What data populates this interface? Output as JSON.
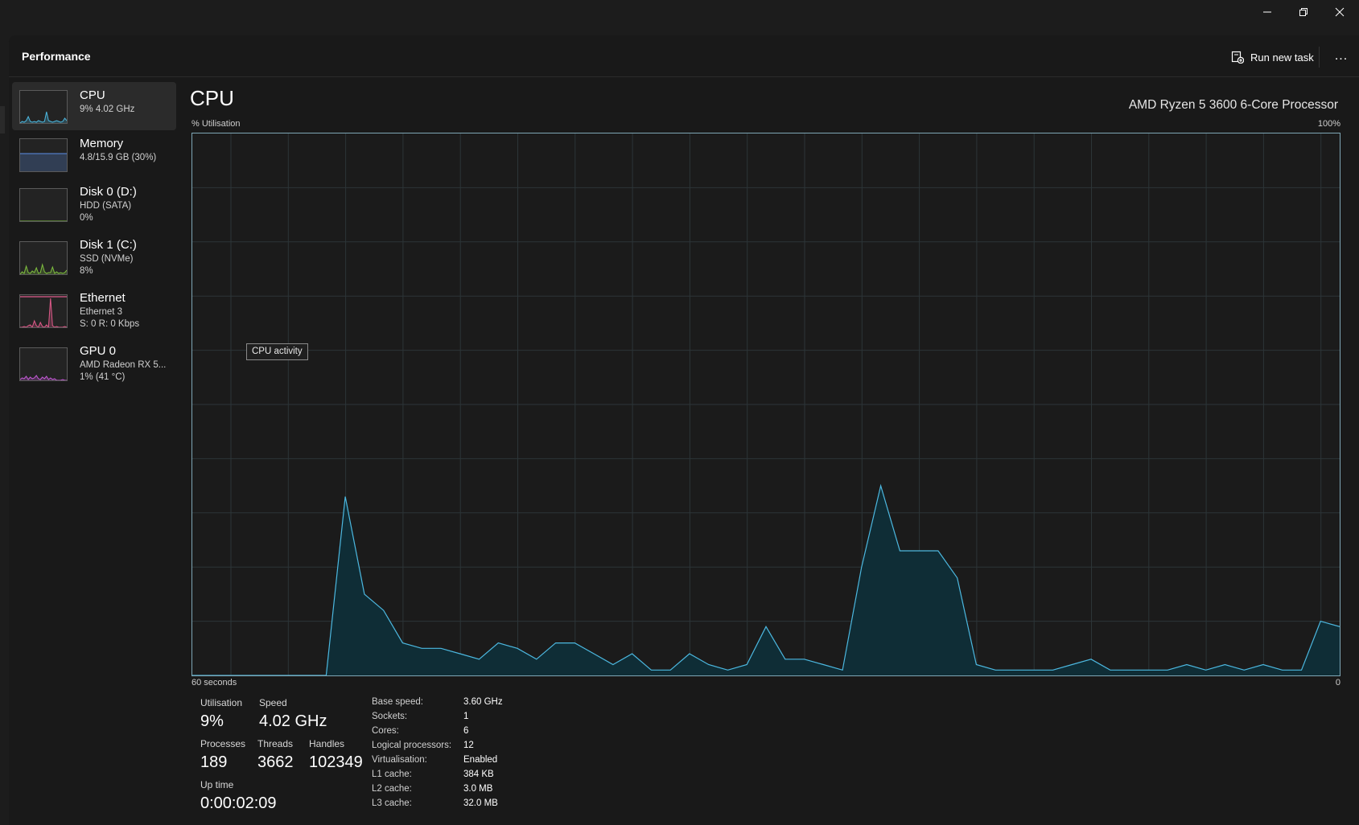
{
  "window": {
    "minimize_icon": "minimize-icon",
    "restore_icon": "restore-icon",
    "close_icon": "close-icon"
  },
  "header": {
    "title": "Performance",
    "run_new_task": "Run new task",
    "more": "..."
  },
  "sidebar": {
    "items": [
      {
        "name": "CPU",
        "line1": "9% 4.02 GHz",
        "line2": "",
        "color": "#4cb8e0",
        "active": true
      },
      {
        "name": "Memory",
        "line1": "4.8/15.9 GB (30%)",
        "line2": "",
        "color": "#5b8ee6",
        "active": false
      },
      {
        "name": "Disk 0 (D:)",
        "line1": "HDD (SATA)",
        "line2": "0%",
        "color": "#7fbf3f",
        "active": false
      },
      {
        "name": "Disk 1 (C:)",
        "line1": "SSD (NVMe)",
        "line2": "8%",
        "color": "#7fbf3f",
        "active": false
      },
      {
        "name": "Ethernet",
        "line1": "Ethernet 3",
        "line2": "S: 0 R: 0 Kbps",
        "color": "#e05a8a",
        "active": false
      },
      {
        "name": "GPU 0",
        "line1": "AMD Radeon RX 5...",
        "line2": "1% (41 °C)",
        "color": "#c45ad6",
        "active": false
      }
    ]
  },
  "main": {
    "title": "CPU",
    "processor": "AMD Ryzen 5 3600 6-Core Processor",
    "chart_top_left": "% Utilisation",
    "chart_top_right": "100%",
    "chart_bottom_left": "60 seconds",
    "chart_bottom_right": "0",
    "tooltip": "CPU activity"
  },
  "chart_data": {
    "type": "area",
    "ylabel": "% Utilisation",
    "ylim": [
      0,
      100
    ],
    "xlim": [
      60,
      0
    ],
    "grid": true,
    "color": "#4cb8e0",
    "values": [
      0,
      0,
      0,
      0,
      0,
      0,
      0,
      0,
      33,
      15,
      12,
      6,
      5,
      5,
      4,
      3,
      6,
      5,
      3,
      6,
      6,
      4,
      2,
      4,
      1,
      1,
      4,
      2,
      1,
      2,
      9,
      3,
      3,
      2,
      1,
      20,
      35,
      23,
      23,
      23,
      18,
      2,
      1,
      1,
      1,
      1,
      2,
      3,
      1,
      1,
      1,
      1,
      2,
      1,
      2,
      1,
      2,
      1,
      1,
      10,
      9
    ]
  },
  "stats": {
    "utilisation_label": "Utilisation",
    "utilisation": "9%",
    "speed_label": "Speed",
    "speed": "4.02 GHz",
    "processes_label": "Processes",
    "processes": "189",
    "threads_label": "Threads",
    "threads": "3662",
    "handles_label": "Handles",
    "handles": "102349",
    "uptime_label": "Up time",
    "uptime": "0:00:02:09"
  },
  "specs": [
    {
      "key": "Base speed:",
      "value": "3.60 GHz"
    },
    {
      "key": "Sockets:",
      "value": "1"
    },
    {
      "key": "Cores:",
      "value": "6"
    },
    {
      "key": "Logical processors:",
      "value": "12"
    },
    {
      "key": "Virtualisation:",
      "value": "Enabled"
    },
    {
      "key": "L1 cache:",
      "value": "384 KB"
    },
    {
      "key": "L2 cache:",
      "value": "3.0 MB"
    },
    {
      "key": "L3 cache:",
      "value": "32.0 MB"
    }
  ]
}
